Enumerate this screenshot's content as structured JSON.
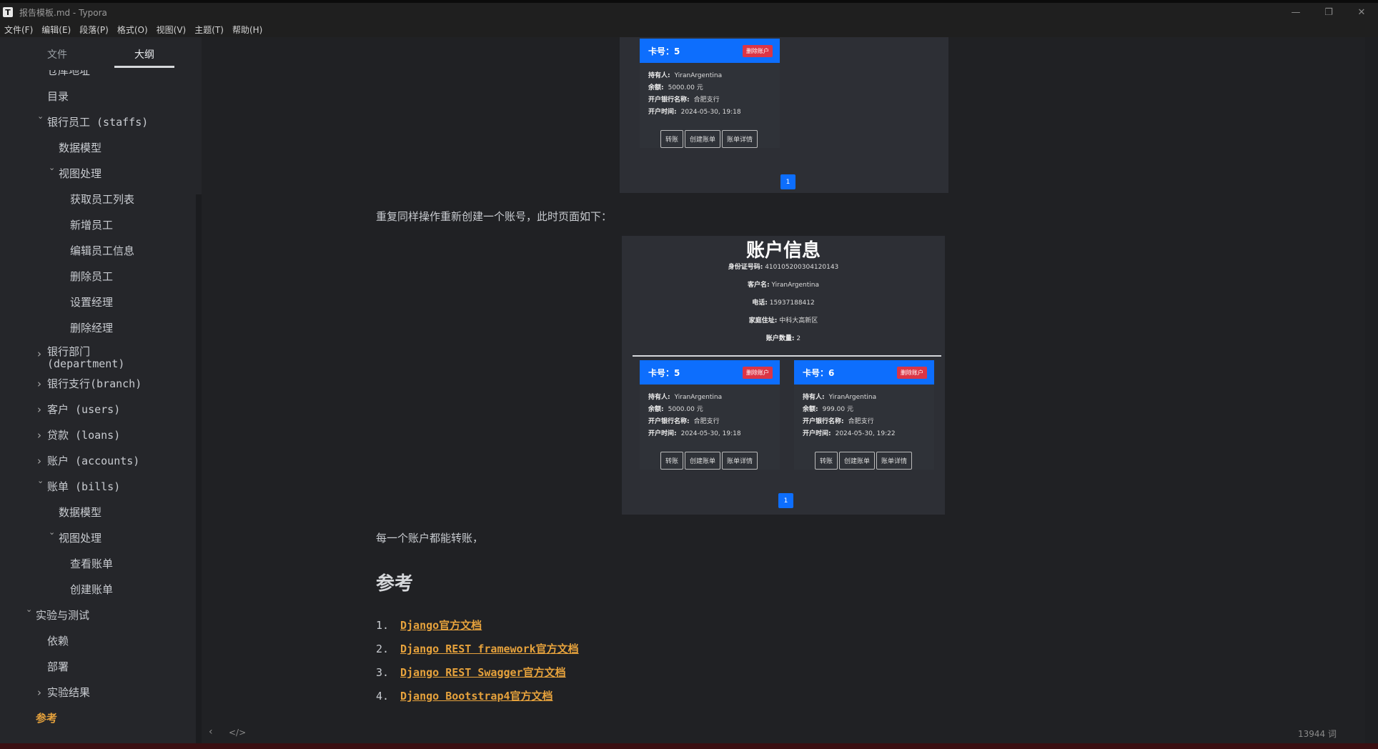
{
  "window": {
    "app_icon": "T",
    "title": "报告模板.md - Typora",
    "controls": [
      "—",
      "❐",
      "✕"
    ]
  },
  "menu": [
    "文件(F)",
    "编辑(E)",
    "段落(P)",
    "格式(O)",
    "视图(V)",
    "主题(T)",
    "帮助(H)"
  ],
  "sidebar": {
    "tabs": [
      "文件",
      "大纲"
    ],
    "active_tab": "大纲",
    "outline": [
      {
        "label": "仓库地址",
        "level": 2,
        "caret": ""
      },
      {
        "label": "目录",
        "level": 2,
        "caret": ""
      },
      {
        "label": "银行员工 (staffs)",
        "level": 2,
        "caret": "expanded"
      },
      {
        "label": "数据模型",
        "level": 3,
        "caret": ""
      },
      {
        "label": "视图处理",
        "level": 3,
        "caret": "expanded"
      },
      {
        "label": "获取员工列表",
        "level": 4,
        "caret": ""
      },
      {
        "label": "新增员工",
        "level": 4,
        "caret": ""
      },
      {
        "label": "编辑员工信息",
        "level": 4,
        "caret": ""
      },
      {
        "label": "删除员工",
        "level": 4,
        "caret": ""
      },
      {
        "label": "设置经理",
        "level": 4,
        "caret": ""
      },
      {
        "label": "删除经理",
        "level": 4,
        "caret": ""
      },
      {
        "label": "银行部门 (department)",
        "level": 2,
        "caret": "collapsed"
      },
      {
        "label": "银行支行(branch)",
        "level": 2,
        "caret": "collapsed"
      },
      {
        "label": "客户 (users)",
        "level": 2,
        "caret": "collapsed"
      },
      {
        "label": "贷款 (loans)",
        "level": 2,
        "caret": "collapsed"
      },
      {
        "label": "账户 (accounts)",
        "level": 2,
        "caret": "collapsed"
      },
      {
        "label": "账单 (bills)",
        "level": 2,
        "caret": "expanded"
      },
      {
        "label": "数据模型",
        "level": 3,
        "caret": ""
      },
      {
        "label": "视图处理",
        "level": 3,
        "caret": "expanded"
      },
      {
        "label": "查看账单",
        "level": 4,
        "caret": ""
      },
      {
        "label": "创建账单",
        "level": 4,
        "caret": ""
      },
      {
        "label": "实验与测试",
        "level": 1,
        "caret": "expanded"
      },
      {
        "label": "依赖",
        "level": 2,
        "caret": ""
      },
      {
        "label": "部署",
        "level": 2,
        "caret": ""
      },
      {
        "label": "实验结果",
        "level": 2,
        "caret": "collapsed"
      },
      {
        "label": "参考",
        "level": 1,
        "caret": "",
        "active": true
      }
    ]
  },
  "document": {
    "para_repeat": "重复同样操作重新创建一个账号，此时页面如下：",
    "para_transfer": "每一个账户都能转账，",
    "heading_refs": "参考",
    "refs": [
      {
        "num": "1.",
        "text": "Django官方文档"
      },
      {
        "num": "2.",
        "text": "Django REST framework官方文档"
      },
      {
        "num": "3.",
        "text": "Django REST Swagger官方文档"
      },
      {
        "num": "4.",
        "text": "Django Bootstrap4官方文档"
      }
    ]
  },
  "screenshot_top": {
    "card": {
      "card_no": "卡号：5",
      "delete": "删除账户",
      "holder_label": "持有人:",
      "holder": "YiranArgentina",
      "balance_label": "余额:",
      "balance": "5000.00 元",
      "bank_label": "开户银行名称:",
      "bank": "合肥支行",
      "time_label": "开户时间:",
      "time": "2024-05-30, 19:18",
      "buttons": [
        "转账",
        "创建账单",
        "账单详情"
      ]
    },
    "page": "1"
  },
  "screenshot_account": {
    "title": "账户信息",
    "id_label": "身份证号码:",
    "id": "410105200304120143",
    "name_label": "客户名:",
    "name": "YiranArgentina",
    "phone_label": "电话:",
    "phone": "15937188412",
    "addr_label": "家庭住址:",
    "addr": "中科大高新区",
    "count_label": "账户数量:",
    "count": "2",
    "cards": [
      {
        "card_no": "卡号：5",
        "delete": "删除账户",
        "holder_label": "持有人:",
        "holder": "YiranArgentina",
        "balance_label": "余额:",
        "balance": "5000.00 元",
        "bank_label": "开户银行名称:",
        "bank": "合肥支行",
        "time_label": "开户时间:",
        "time": "2024-05-30, 19:18",
        "buttons": [
          "转账",
          "创建账单",
          "账单详情"
        ]
      },
      {
        "card_no": "卡号：6",
        "delete": "删除账户",
        "holder_label": "持有人:",
        "holder": "YiranArgentina",
        "balance_label": "余额:",
        "balance": "999.00 元",
        "bank_label": "开户银行名称:",
        "bank": "合肥支行",
        "time_label": "开户时间:",
        "time": "2024-05-30, 19:22",
        "buttons": [
          "转账",
          "创建账单",
          "账单详情"
        ]
      }
    ],
    "page": "1"
  },
  "statusbar": {
    "word_count": "13944 词",
    "back_icon": "chevron-left-icon",
    "source_icon": "code-icon"
  },
  "colors": {
    "accent": "#e6a23c",
    "primary_blue": "#0d6efd",
    "danger": "#dc3545"
  }
}
